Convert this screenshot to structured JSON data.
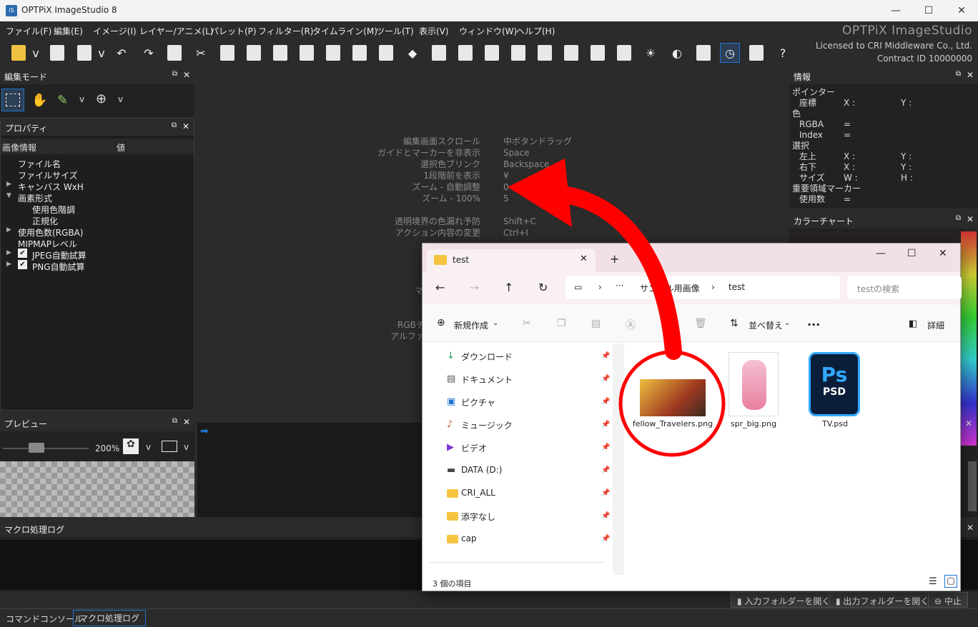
{
  "window": {
    "title": "OPTPiX ImageStudio 8",
    "app_icon": "iS"
  },
  "menu": [
    "ファイル(F)",
    "編集(E)",
    "イメージ(I)",
    "レイヤー/アニメ(L)",
    "パレット(P)",
    "フィルター(R)",
    "タイムライン(M)",
    "ツール(T)",
    "表示(V)",
    "ウィンドウ(W)",
    "ヘルプ(H)"
  ],
  "brand": {
    "name": "OPTPiX ImageStudio",
    "license": "Licensed to CRI Middleware Co., Ltd.",
    "contract": "Contract ID 10000000"
  },
  "panels": {
    "edit_mode": "編集モード",
    "properties": "プロパティ",
    "prop_cols": [
      "画像情報",
      "値"
    ],
    "prop_items": [
      "ファイル名",
      "ファイルサイズ",
      "キャンバス WxH",
      "画素形式",
      "使用色階調",
      "正規化",
      "使用色数(RGBA)",
      "MIPMAPレベル",
      "JPEG自動試算",
      "PNG自動試算"
    ],
    "preview": "プレビュー",
    "zoom": "200%",
    "macro_log": "マクロ処理ログ",
    "info": "情報",
    "info_rows": [
      "ポインター",
      "座標",
      "X :",
      "Y :",
      "色",
      "RGBA",
      "=",
      "Index",
      "=",
      "選択",
      "左上",
      "X :",
      "Y :",
      "右下",
      "X :",
      "Y :",
      "サイズ",
      "W :",
      "H :",
      "重要領域マーカー",
      "使用数",
      "="
    ],
    "color_chart": "カラーチャート"
  },
  "shortcuts": [
    {
      "label": "編集画面スクロール",
      "key": "中ボタンドラッグ"
    },
    {
      "label": "ガイドとマーカーを非表示",
      "key": "Space"
    },
    {
      "label": "選択色ブリンク",
      "key": "Backspace"
    },
    {
      "label": "1段階前を表示",
      "key": "¥"
    },
    {
      "label": "ズーム - 自動調整",
      "key": "0"
    },
    {
      "label": "ズーム - 100%",
      "key": "5"
    },
    {
      "label": "透明境界の色漏れ予防",
      "key": "Shift+C"
    },
    {
      "label": "アクション内容の変更",
      "key": "Ctrl+I"
    }
  ],
  "canvas_partial": [
    "マ",
    "RGBチ",
    "アルファチ"
  ],
  "explorer": {
    "tab": "test",
    "addr": [
      "サンプル用画像",
      "test"
    ],
    "search_placeholder": "testの検索",
    "new": "新規作成",
    "sort": "並べ替え",
    "more": "...",
    "details": "詳細",
    "nav": [
      "ダウンロード",
      "ドキュメント",
      "ピクチャ",
      "ミュージック",
      "ビデオ",
      "DATA (D:)",
      "CRI_ALL",
      "添字なし",
      "cap"
    ],
    "files": [
      "fellow_Travelers.png",
      "spr_big.png",
      "TV.psd"
    ],
    "status": "3 個の項目"
  },
  "bottom": {
    "in": "入力フォルダーを開く",
    "out": "出力フォルダーを開く",
    "stop": "中止"
  },
  "tabs": [
    "コマンドコンソール",
    "マクロ処理ログ"
  ],
  "colors": {
    "accent": "#1e73d2",
    "arrow": "#ff0000"
  }
}
